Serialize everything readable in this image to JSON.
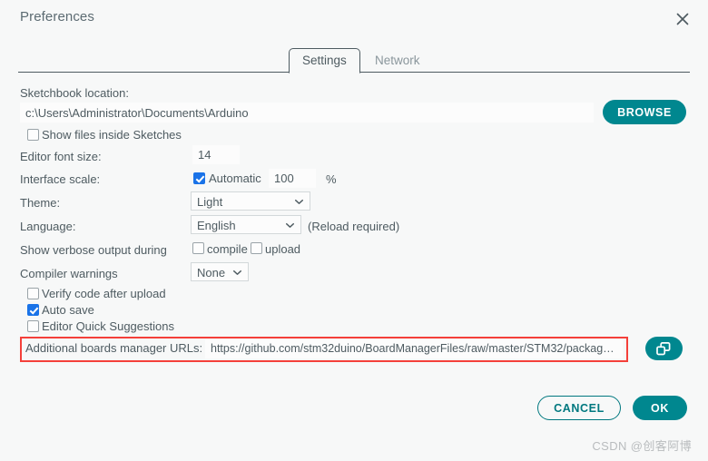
{
  "window": {
    "title": "Preferences",
    "close_icon": "close-icon"
  },
  "tabs": [
    {
      "label": "Settings",
      "active": true
    },
    {
      "label": "Network",
      "active": false
    }
  ],
  "settings": {
    "sketchbook": {
      "label": "Sketchbook location:",
      "value": "c:\\Users\\Administrator\\Documents\\Arduino",
      "browse_label": "BROWSE"
    },
    "show_files_inside_sketches": {
      "label": "Show files inside Sketches",
      "checked": false
    },
    "editor_font_size": {
      "label": "Editor font size:",
      "value": "14"
    },
    "interface_scale": {
      "label": "Interface scale:",
      "automatic_label": "Automatic",
      "automatic_checked": true,
      "value": "100",
      "unit": "%"
    },
    "theme": {
      "label": "Theme:",
      "value": "Light",
      "options": [
        "Light"
      ]
    },
    "language": {
      "label": "Language:",
      "value": "English",
      "options": [
        "English"
      ],
      "note": "(Reload required)"
    },
    "verbose_output": {
      "label": "Show verbose output during",
      "compile_label": "compile",
      "compile_checked": false,
      "upload_label": "upload",
      "upload_checked": false
    },
    "compiler_warnings": {
      "label": "Compiler warnings",
      "value": "None",
      "options": [
        "None"
      ]
    },
    "verify_code_after_upload": {
      "label": "Verify code after upload",
      "checked": false
    },
    "auto_save": {
      "label": "Auto save",
      "checked": true
    },
    "editor_quick_suggestions": {
      "label": "Editor Quick Suggestions",
      "checked": false
    },
    "additional_urls": {
      "label": "Additional boards manager URLs:",
      "value": "https://github.com/stm32duino/BoardManagerFiles/raw/master/STM32/packag…",
      "expand_icon": "copy-window-icon"
    }
  },
  "footer": {
    "cancel_label": "CANCEL",
    "ok_label": "OK"
  },
  "watermark": "CSDN @创客阿博",
  "colors": {
    "accent_teal": "#00878f",
    "accent_teal_dark": "#00787f",
    "checkbox_blue": "#1a73e8",
    "highlight_red": "#f4403a",
    "background": "#f7f8f8",
    "text": "#4e5b61"
  }
}
